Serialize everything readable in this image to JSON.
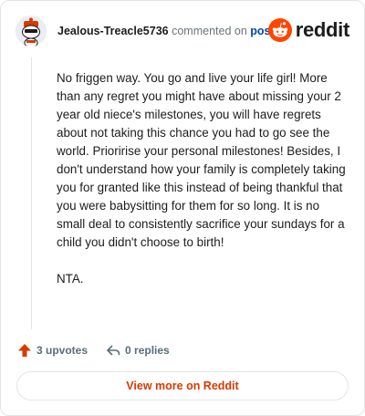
{
  "comment": {
    "username": "Jealous-Treacle5736",
    "action_text": "commented on",
    "post_link": "post",
    "paragraphs": [
      "No friggen way. You go and live your life girl! More than any regret you might have about missing your 2 year old niece's milestones, you will have regrets about not taking this chance you had to go see the world. Prioririse your personal milestones! Besides, I don't understand how your family is completely taking you for granted like this instead of being thankful that you were babysitting for them for so long. It is no small deal to consistently sacrifice your sundays for a child you didn't choose to birth!",
      "NTA."
    ]
  },
  "brand": {
    "wordmark": "reddit",
    "color": "#ff4500"
  },
  "stats": {
    "upvotes": "3 upvotes",
    "replies": "0 replies"
  },
  "footer": {
    "view_button": "View more on Reddit"
  },
  "colors": {
    "accent": "#d93900",
    "upvote": "#d93900",
    "link": "#0045ac"
  }
}
